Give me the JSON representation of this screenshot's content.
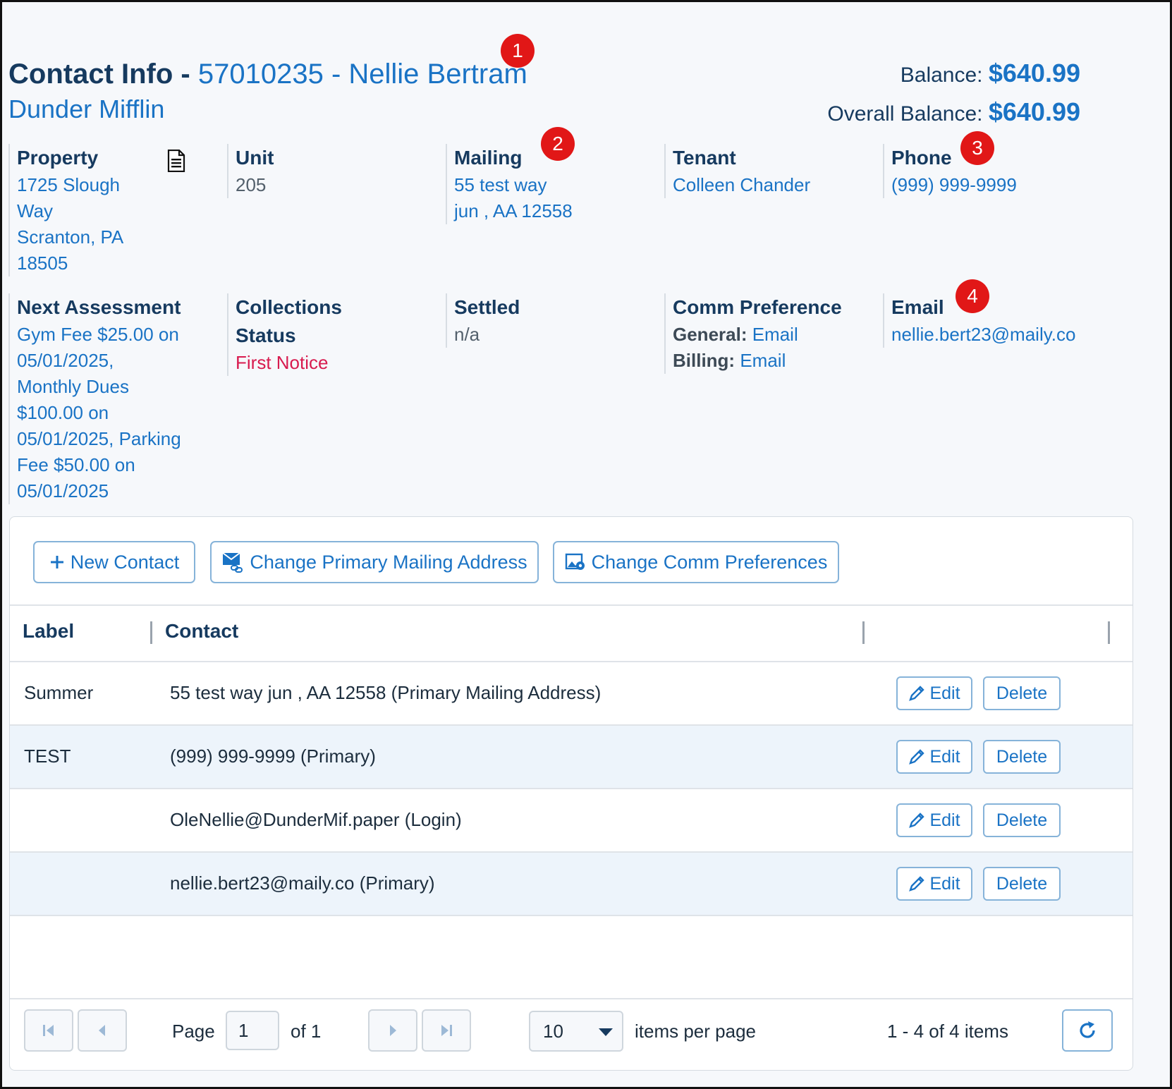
{
  "header": {
    "title_prefix": "Contact Info - ",
    "title_account": "57010235 - Nellie Bertram",
    "company": "Dunder Mifflin",
    "balance_label": "Balance: ",
    "balance_value": "$640.99",
    "overall_label": "Overall Balance: ",
    "overall_value": "$640.99"
  },
  "badges": [
    "1",
    "2",
    "3",
    "4"
  ],
  "info": {
    "property": {
      "label": "Property",
      "lines": [
        "1725 Slough",
        "Way",
        "Scranton, PA",
        "18505"
      ]
    },
    "unit": {
      "label": "Unit",
      "value": "205"
    },
    "mailing": {
      "label": "Mailing",
      "lines": [
        "55 test way",
        "jun , AA 12558"
      ]
    },
    "tenant": {
      "label": "Tenant",
      "value": "Colleen Chander"
    },
    "phone": {
      "label": "Phone",
      "value": "(999) 999-9999"
    },
    "next_assessment": {
      "label": "Next Assessment",
      "lines": [
        "Gym Fee $25.00 on",
        "05/01/2025,",
        "Monthly Dues",
        "$100.00 on",
        "05/01/2025, Parking",
        "Fee $50.00 on",
        "05/01/2025"
      ]
    },
    "collections": {
      "label_1": "Collections",
      "label_2": "Status",
      "value": "First Notice"
    },
    "settled": {
      "label": "Settled",
      "value": "n/a"
    },
    "comm_pref": {
      "label": "Comm Preference",
      "general_label": "General: ",
      "general_value": "Email",
      "billing_label": "Billing: ",
      "billing_value": "Email"
    },
    "email": {
      "label": "Email",
      "value": "nellie.bert23@maily.co"
    }
  },
  "toolbar": {
    "new_contact": "New Contact",
    "change_mailing": "Change Primary Mailing Address",
    "change_comm": "Change Comm Preferences"
  },
  "table": {
    "headers": {
      "label": "Label",
      "contact": "Contact"
    },
    "rows": [
      {
        "label": "Summer",
        "contact": "55 test way jun , AA 12558 (Primary Mailing Address)"
      },
      {
        "label": "TEST",
        "contact": "(999) 999-9999 (Primary)"
      },
      {
        "label": "",
        "contact": "OleNellie@DunderMif.paper (Login)"
      },
      {
        "label": "",
        "contact": "nellie.bert23@maily.co (Primary)"
      }
    ],
    "edit_label": "Edit",
    "delete_label": "Delete"
  },
  "pager": {
    "page_label": "Page",
    "page_value": "1",
    "of_label": "of 1",
    "per_page_value": "10",
    "per_page_label": "items per page",
    "summary": "1 - 4 of 4 items"
  },
  "colors": {
    "accent": "#1a73c5",
    "heading": "#163a5f",
    "badge": "#e11717",
    "warning": "#d81b4f"
  }
}
